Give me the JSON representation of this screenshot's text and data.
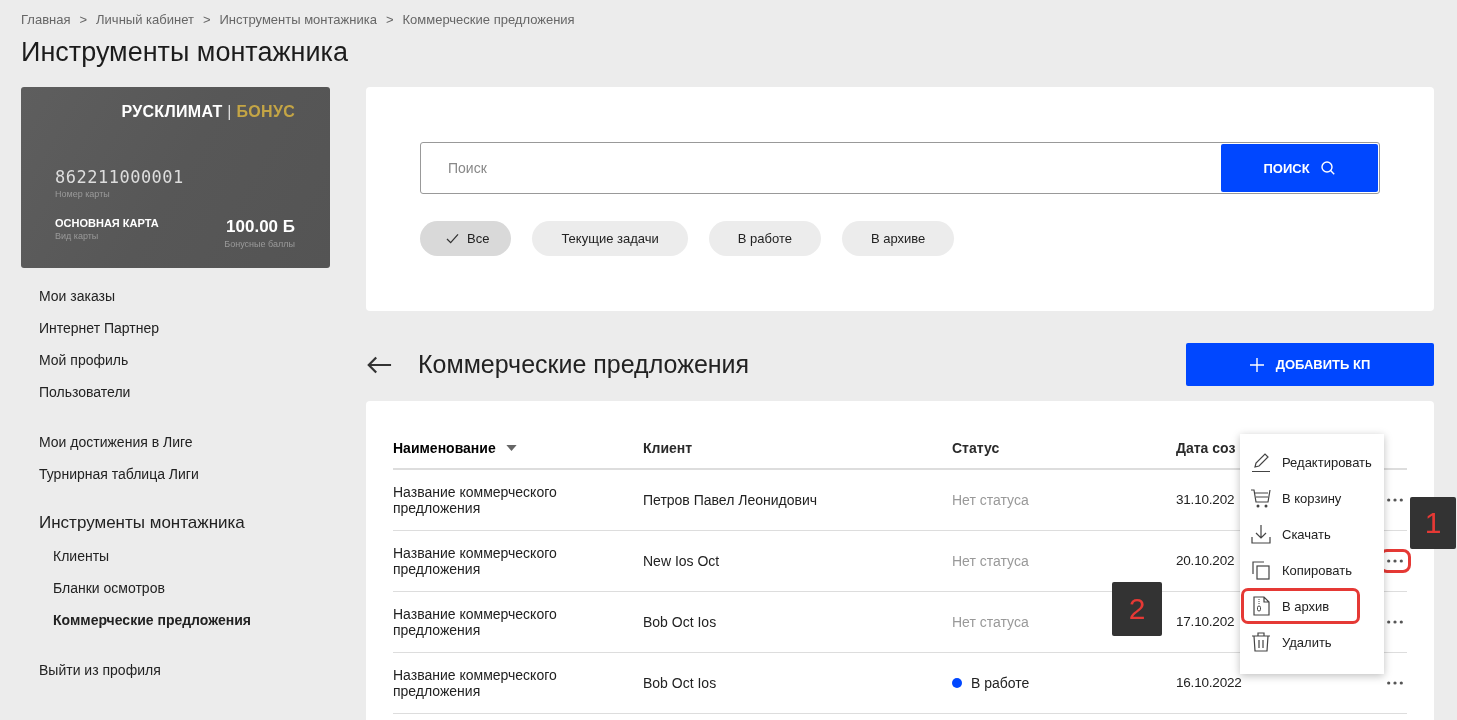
{
  "breadcrumbs": [
    "Главная",
    "Личный кабинет",
    "Инструменты монтажника",
    "Коммерческие предложения"
  ],
  "breadcrumb_separator": ">",
  "page_title": "Инструменты монтажника",
  "bonus_card": {
    "brand": "РУСКЛИМАТ",
    "divider": "|",
    "program": "БОНУС",
    "number": "862211000001",
    "number_label": "Номер карты",
    "card_type": "ОСНОВНАЯ КАРТА",
    "card_type_label": "Вид карты",
    "points": "100.00 Б",
    "points_label": "Бонусные баллы"
  },
  "sidebar": {
    "groups": [
      {
        "items": [
          {
            "label": "Мои заказы",
            "selected": false
          },
          {
            "label": "Интернет Партнер",
            "selected": false
          },
          {
            "label": "Мой профиль",
            "selected": false
          },
          {
            "label": "Пользователи",
            "selected": false
          }
        ]
      },
      {
        "items": [
          {
            "label": "Мои достижения в Лиге",
            "selected": false
          },
          {
            "label": "Турнирная таблица Лиги",
            "selected": false
          }
        ]
      },
      {
        "title": "Инструменты монтажника",
        "items": [
          {
            "label": "Клиенты",
            "selected": false
          },
          {
            "label": "Бланки осмотров",
            "selected": false
          },
          {
            "label": "Коммерческие предложения",
            "selected": true
          }
        ]
      },
      {
        "items": [
          {
            "label": "Выйти из профиля",
            "selected": false
          }
        ]
      }
    ]
  },
  "search": {
    "placeholder": "Поиск",
    "button": "ПОИСК"
  },
  "filters": [
    {
      "label": "Все",
      "selected": true
    },
    {
      "label": "Текущие задачи",
      "selected": false
    },
    {
      "label": "В работе",
      "selected": false
    },
    {
      "label": "В архиве",
      "selected": false
    }
  ],
  "section": {
    "title": "Коммерческие предложения",
    "add_button": "ДОБАВИТЬ КП"
  },
  "table": {
    "columns": [
      {
        "label": "Наименование",
        "sorted": true
      },
      {
        "label": "Клиент",
        "sorted": false
      },
      {
        "label": "Статус",
        "sorted": false
      },
      {
        "label": "Дата соз",
        "sorted": false
      }
    ],
    "rows": [
      {
        "name": "Название коммерческого предложения",
        "client": "Петров Павел Леонидович",
        "status": {
          "text": "Нет статуса",
          "kind": "empty"
        },
        "date": "31.10.202",
        "menu_highlighted": false
      },
      {
        "name": "Название коммерческого предложения",
        "client": "New Ios Oct",
        "status": {
          "text": "Нет статуса",
          "kind": "empty"
        },
        "date": "20.10.202",
        "menu_highlighted": true
      },
      {
        "name": "Название коммерческого предложения",
        "client": "Bob Oct Ios",
        "status": {
          "text": "Нет статуса",
          "kind": "empty"
        },
        "date": "17.10.202",
        "menu_highlighted": false
      },
      {
        "name": "Название коммерческого предложения",
        "client": "Bob Oct Ios",
        "status": {
          "text": "В работе",
          "kind": "dot",
          "color": "#0047ff"
        },
        "date": "16.10.2022",
        "menu_highlighted": false
      }
    ]
  },
  "row_menu": {
    "items": [
      {
        "label": "Редактировать",
        "kind": "edit",
        "highlighted": false
      },
      {
        "label": "В корзину",
        "kind": "cart",
        "highlighted": false
      },
      {
        "label": "Скачать",
        "kind": "download",
        "highlighted": false
      },
      {
        "label": "Копировать",
        "kind": "copy",
        "highlighted": false
      },
      {
        "label": "В архив",
        "kind": "archive",
        "highlighted": true
      },
      {
        "label": "Удалить",
        "kind": "delete",
        "highlighted": false
      }
    ]
  },
  "callouts": [
    {
      "label": "1"
    },
    {
      "label": "2"
    }
  ]
}
